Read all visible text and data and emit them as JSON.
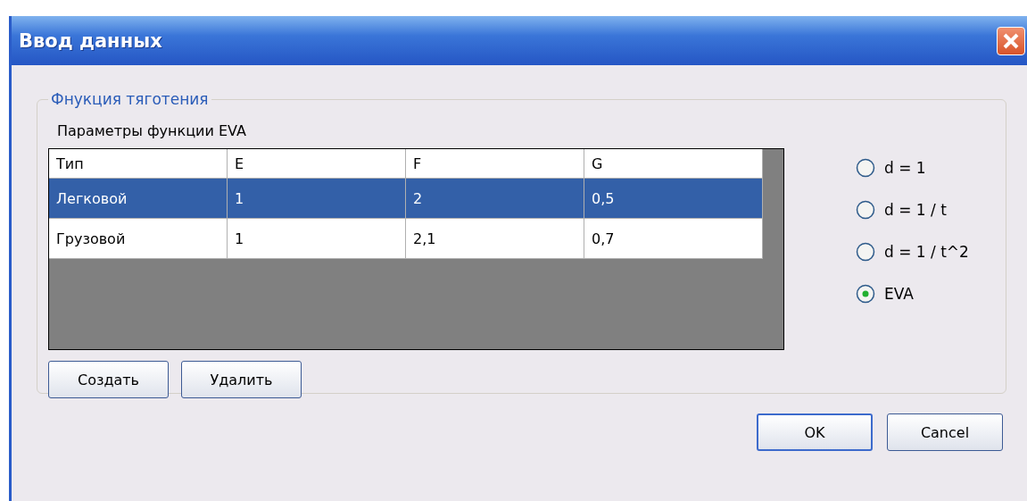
{
  "window": {
    "title": "Ввод данных"
  },
  "group": {
    "legend": "Фнукция тяготения",
    "label": "Параметры функции EVA"
  },
  "table": {
    "columns": [
      "Тип",
      "E",
      "F",
      "G"
    ],
    "rows": [
      {
        "cells": [
          "Легковой",
          "1",
          "2",
          "0,5"
        ],
        "selected": true
      },
      {
        "cells": [
          "Грузовой",
          "1",
          "2,1",
          "0,7"
        ],
        "selected": false
      }
    ]
  },
  "options": [
    {
      "label": "d = 1",
      "selected": false
    },
    {
      "label": "d = 1 / t",
      "selected": false
    },
    {
      "label": "d = 1 / t^2",
      "selected": false
    },
    {
      "label": "EVA",
      "selected": true
    }
  ],
  "table_buttons": [
    "Создать",
    "Удалить"
  ],
  "dialog_buttons": [
    {
      "label": "OK",
      "default": true
    },
    {
      "label": "Cancel",
      "default": false
    }
  ]
}
